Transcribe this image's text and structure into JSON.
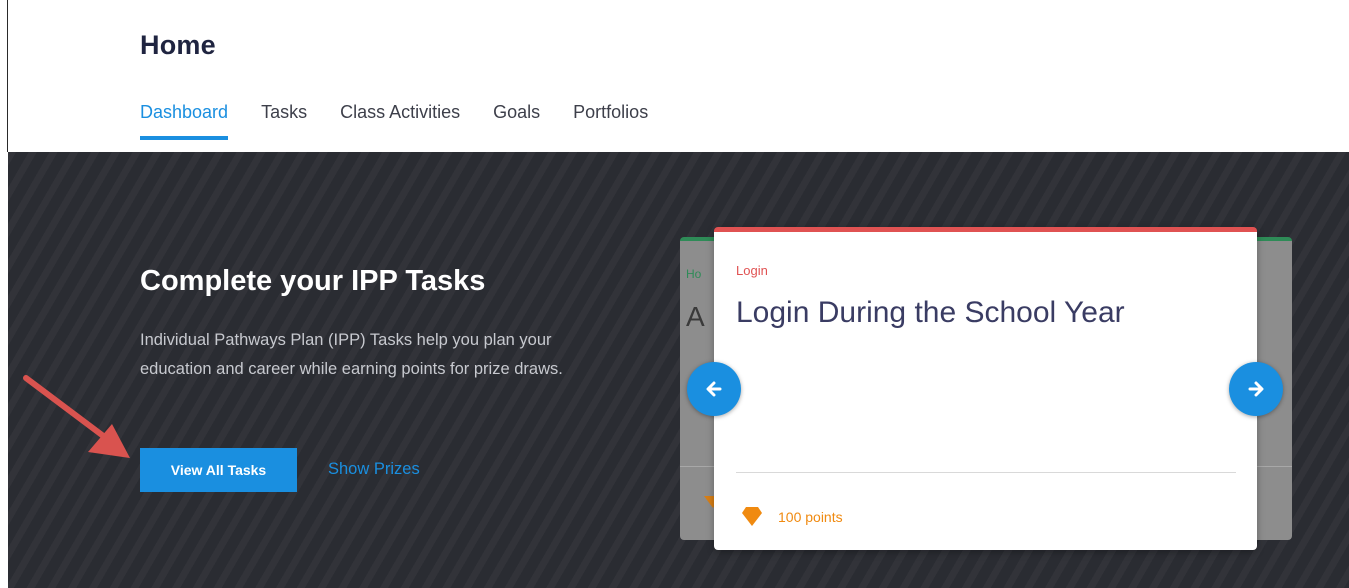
{
  "header": {
    "title": "Home",
    "tabs": [
      {
        "label": "Dashboard",
        "active": true
      },
      {
        "label": "Tasks",
        "active": false
      },
      {
        "label": "Class Activities",
        "active": false
      },
      {
        "label": "Goals",
        "active": false
      },
      {
        "label": "Portfolios",
        "active": false
      }
    ]
  },
  "hero": {
    "title": "Complete your IPP Tasks",
    "description": "Individual Pathways Plan (IPP) Tasks help you plan your education and career while earning points for prize draws.",
    "primary_button": "View All Tasks",
    "secondary_link": "Show Prizes"
  },
  "carousel": {
    "back_card": {
      "label": "Ho",
      "title": "A"
    },
    "card": {
      "category": "Login",
      "title": "Login During the School Year",
      "points": "100 points"
    },
    "prev_icon": "arrow-left-icon",
    "next_icon": "arrow-right-icon"
  },
  "colors": {
    "accent": "#1a8fe0",
    "hero_bg": "#2a2c32",
    "card_accent": "#e05252",
    "back_card_accent": "#2e8b57",
    "points": "#f08a10",
    "annotation_arrow": "#d9534f"
  }
}
